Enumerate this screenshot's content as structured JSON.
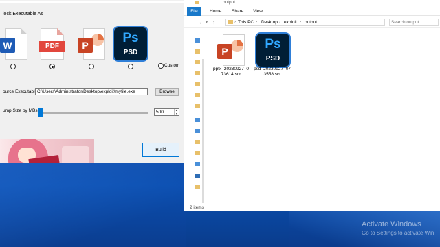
{
  "builder": {
    "lock_label": "lock Executable As",
    "file_types": [
      {
        "name": "word",
        "badge": "W",
        "checked": false
      },
      {
        "name": "pdf",
        "badge": "PDF",
        "checked": true
      },
      {
        "name": "powerpoint",
        "badge": "P",
        "checked": false
      },
      {
        "name": "photoshop",
        "badge": "PSD",
        "checked": false
      }
    ],
    "ps_badge": "Ps",
    "custom_label": "Custom",
    "source_label": "ource Executable:",
    "source_value": "C:\\Users\\Administrator\\Desktop\\exploit\\myfile.exe",
    "browse_label": "Browse",
    "dump_label": "ump Size by MBs:",
    "dump_value": "500",
    "build_label": "Build"
  },
  "explorer": {
    "title": "output",
    "tabs": [
      "File",
      "Home",
      "Share",
      "View"
    ],
    "breadcrumb": [
      "This PC",
      "Desktop",
      "exploit",
      "output"
    ],
    "search_placeholder": "Search output",
    "files": [
      {
        "name": "pptx_20230927_073614.scr",
        "line1": "pptx_20230927_0",
        "line2": "73614.scr",
        "icon": "powerpoint-file-icon"
      },
      {
        "name": "psd_20230927_073558.scr",
        "line1": "psd_20230927_07",
        "line2": "3558.scr",
        "icon": "photoshop-file-icon"
      }
    ],
    "status": "2 items"
  },
  "watermark": {
    "title": "Activate Windows",
    "subtitle": "Go to Settings to activate Win"
  },
  "colors": {
    "file_tab": "#1979ca",
    "ps_dark": "#001e36",
    "ps_blue": "#31a8ff",
    "pdf_red": "#e2473d",
    "word_blue": "#1e5bb5",
    "ppt_orange": "#c84424",
    "desktop": "#0b3a8f"
  }
}
